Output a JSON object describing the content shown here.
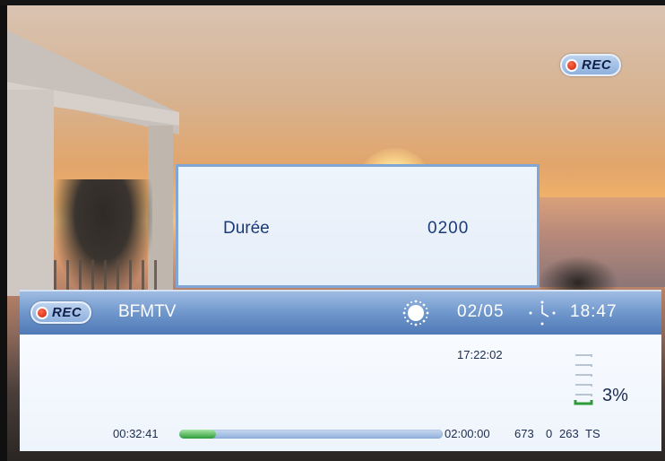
{
  "top_badge": {
    "label": "REC"
  },
  "dialog": {
    "key": "Durée",
    "value": "0200"
  },
  "infobar": {
    "rec_label": "REC",
    "channel": "BFMTV",
    "weather_icon": "sun-icon",
    "date": "02/05",
    "clock_icon": "clock-icon",
    "time": "18:47",
    "current_time": "17:22:02",
    "start_time": "00:32:41",
    "end_time": "02:00:00",
    "stat_1": "673",
    "stat_2": "0",
    "stat_3": "263",
    "stat_4": "TS",
    "progress_fraction": 0.14,
    "disk_usage_label": "3%",
    "disk_usage_fraction": 0.03
  },
  "colors": {
    "accent": "#4f79b6",
    "progress_fill": "#2e9b3a",
    "rec_dot": "#c81e0a"
  }
}
